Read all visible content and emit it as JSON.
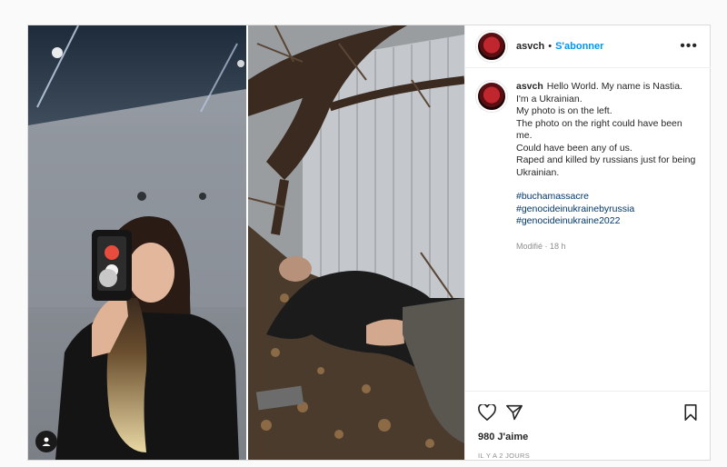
{
  "post": {
    "username": "asvch",
    "separator": "•",
    "follow_label": "S'abonner",
    "more_label": "•••",
    "caption_lines": [
      "Hello World. My name is Nastia.",
      "I'm a Ukrainian.",
      "My photo is on the left.",
      "The photo on the right could have been me.",
      "Could have been any of us.",
      "Raped and killed by russians just for being Ukrainian."
    ],
    "hashtags": [
      "#buchamassacre",
      "#genocideinukrainebyrussia",
      "#genocideinukraine2022"
    ],
    "modified": "Modifié · 18 h",
    "likes": "980 J'aime",
    "date": "IL Y A 2 JOURS"
  },
  "colors": {
    "accent": "#0095f6",
    "hashtag": "#00376b",
    "muted": "#8e8e8e"
  },
  "icons": [
    "heart-icon",
    "send-icon",
    "bookmark-icon",
    "more-icon",
    "user-tag-icon"
  ]
}
